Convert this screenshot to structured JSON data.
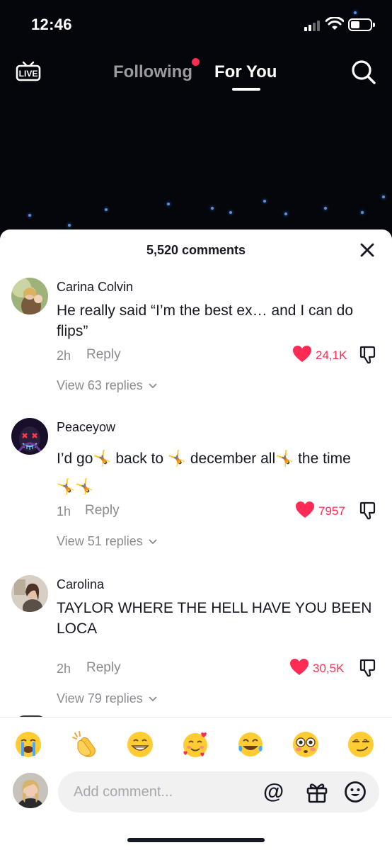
{
  "status_bar": {
    "time": "12:46"
  },
  "top_nav": {
    "live_label": "LIVE",
    "tabs": [
      {
        "label": "Following",
        "has_notification_dot": true
      },
      {
        "label": "For You",
        "active": true
      }
    ]
  },
  "comments_sheet": {
    "count_label": "5,520 comments",
    "comments": [
      {
        "username": "Carina Colvin",
        "text": "He really said “I’m the best ex… and I can do flips”",
        "time": "2h",
        "reply_label": "Reply",
        "likes": "24,1K",
        "view_replies": "View 63 replies"
      },
      {
        "username": "Peaceyow",
        "text": "I’d go🤸 back to 🤸 december all🤸 the time 🤸🤸",
        "time": "1h",
        "reply_label": "Reply",
        "likes": "7957",
        "view_replies": "View 51 replies"
      },
      {
        "username": "Carolina",
        "text": "TAYLOR WHERE THE HELL HAVE YOU BEEN LOCA",
        "time": "2h",
        "reply_label": "Reply",
        "likes": "30,5K",
        "view_replies": "View 79 replies"
      }
    ]
  },
  "emoji_bar": {
    "emojis": [
      "😭",
      "👏",
      "😁",
      "🥰",
      "😂",
      "😳",
      "😏"
    ]
  },
  "comment_input": {
    "placeholder": "Add comment...",
    "at_label": "@"
  },
  "colors": {
    "accent": "#fe2c55",
    "text_primary": "#161823",
    "text_secondary": "#8a8b91"
  }
}
